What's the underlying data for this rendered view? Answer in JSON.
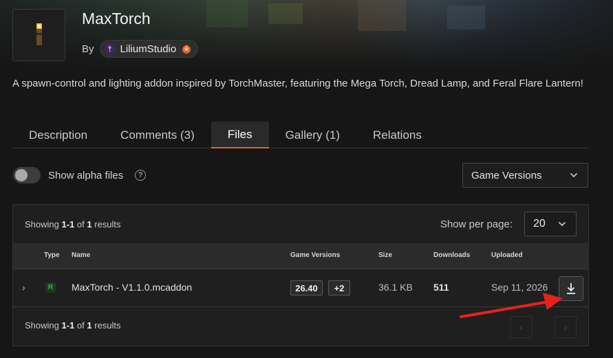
{
  "project": {
    "name": "MaxTorch",
    "by_label": "By",
    "author": "LiliumStudio",
    "description": "A spawn-control and lighting addon inspired by TorchMaster, featuring the Mega Torch, Dread Lamp, and Feral Flare Lantern!"
  },
  "tabs": [
    {
      "label": "Description"
    },
    {
      "label": "Comments (3)"
    },
    {
      "label": "Files"
    },
    {
      "label": "Gallery (1)"
    },
    {
      "label": "Relations"
    }
  ],
  "active_tab": "Files",
  "filters": {
    "alpha_label": "Show alpha files",
    "alpha_enabled": false,
    "help_glyph": "?",
    "game_versions_label": "Game Versions"
  },
  "results": {
    "showing_prefix": "Showing",
    "range": "1-1",
    "of_label": "of",
    "total": "1",
    "suffix": "results",
    "per_page_label": "Show per page:",
    "per_page_value": "20"
  },
  "table": {
    "headers": {
      "type": "Type",
      "name": "Name",
      "game_versions": "Game Versions",
      "size": "Size",
      "downloads": "Downloads",
      "uploaded": "Uploaded"
    },
    "rows": [
      {
        "type": "R",
        "name": "MaxTorch - V1.1.0.mcaddon",
        "version": "26.40",
        "more_versions": "+2",
        "size": "36.1 KB",
        "downloads": "511",
        "uploaded": "Sep 11, 2026"
      }
    ]
  },
  "pagination": {
    "prev_glyph": "‹",
    "next_glyph": "›"
  },
  "colors": {
    "accent": "#e0673a",
    "annotation_arrow": "#e8211f",
    "release_badge": "#5fcf72"
  }
}
